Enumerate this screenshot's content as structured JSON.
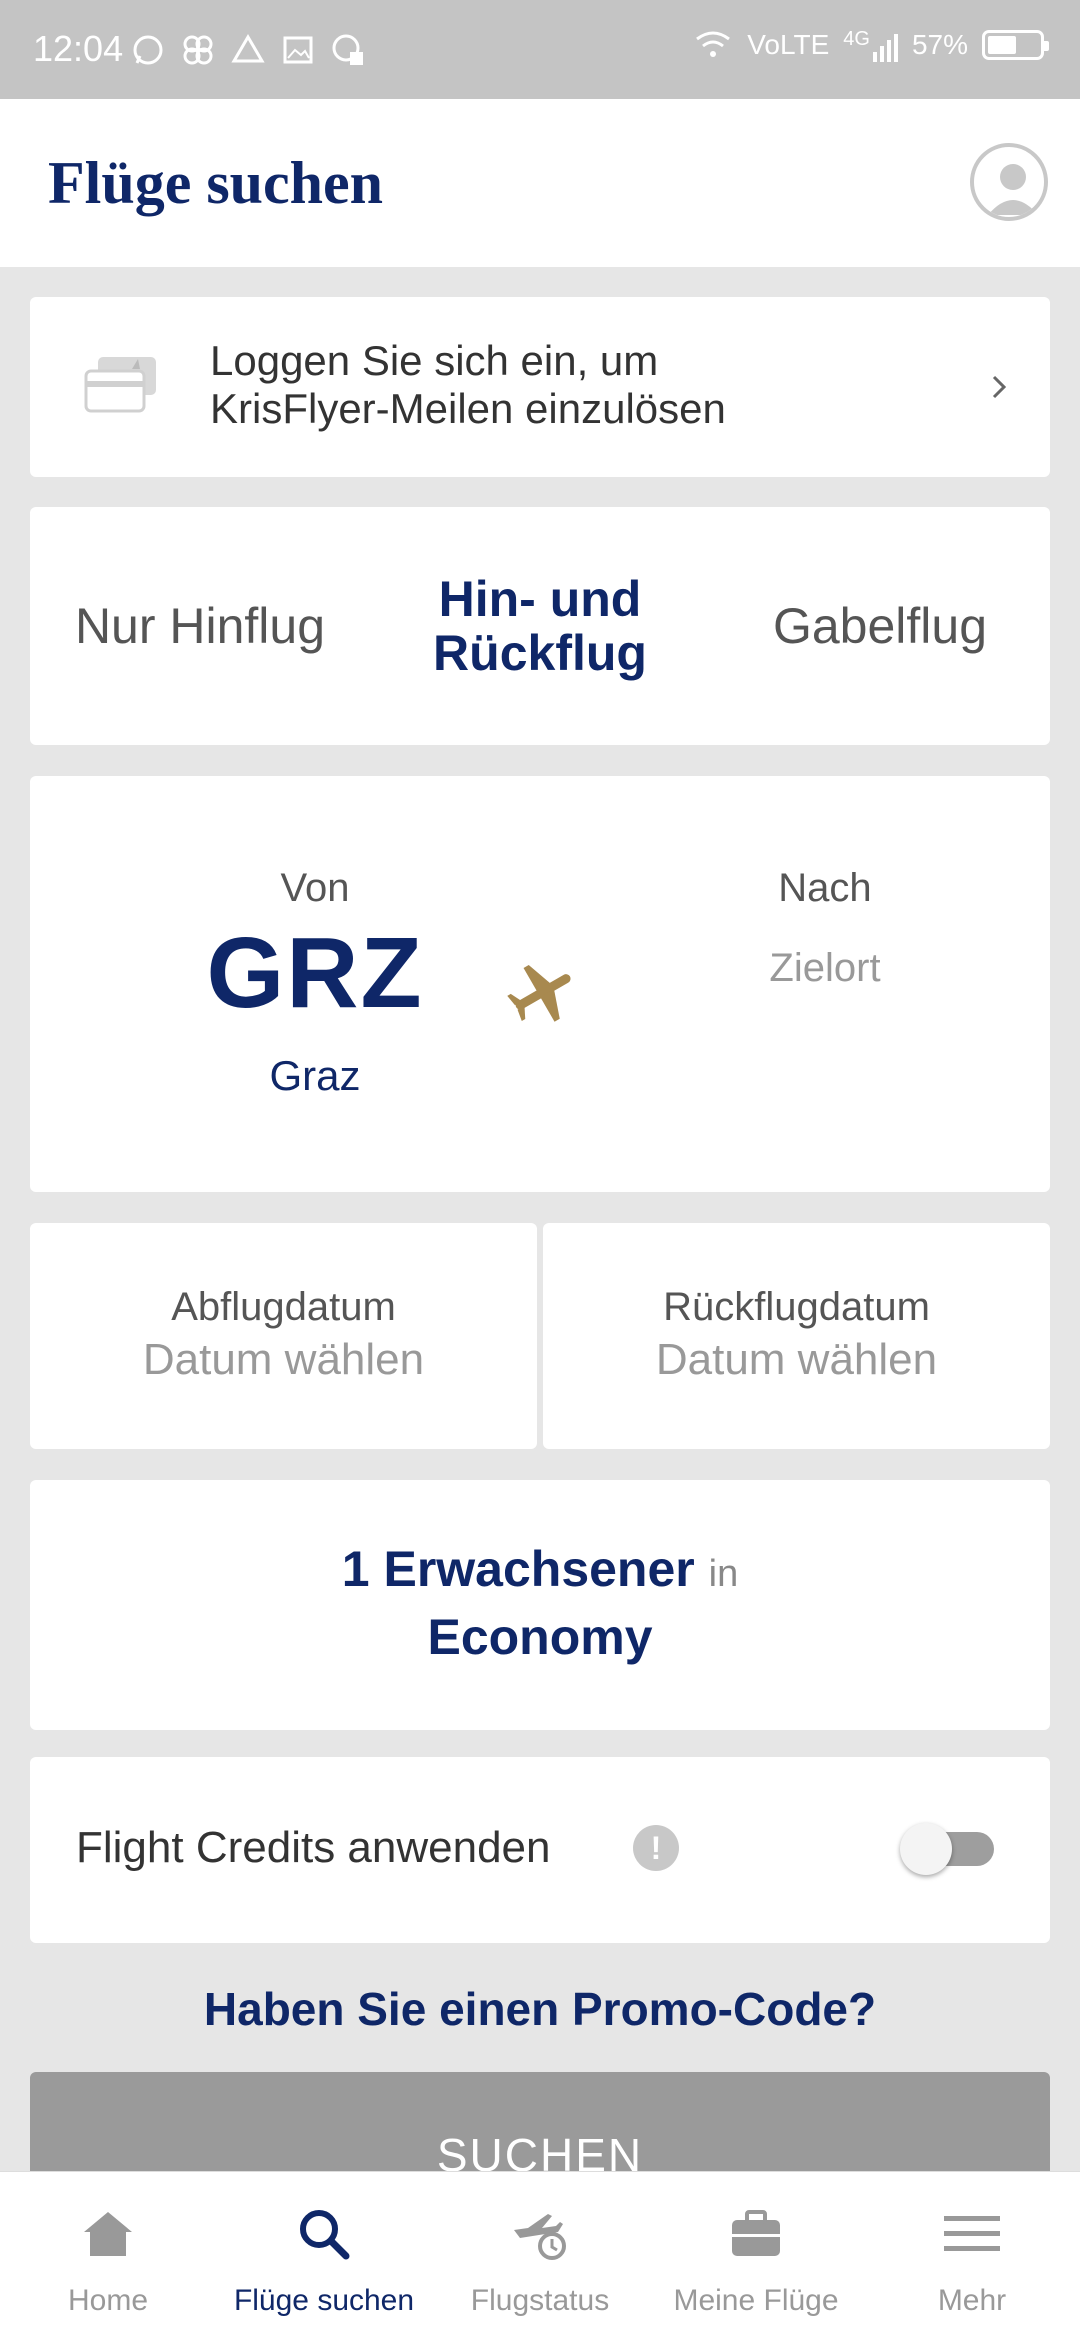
{
  "status_bar": {
    "time": "12:04",
    "network": "VoLTE",
    "signal": "4G",
    "battery": "57%",
    "notification_icons": [
      "whatsapp-icon",
      "pinwheel-icon",
      "drive-icon",
      "gallery-icon",
      "clock-icon"
    ]
  },
  "header": {
    "title": "Flüge suchen",
    "profile_icon": "user-avatar-icon"
  },
  "login_banner": {
    "line1": "Loggen Sie sich ein, um",
    "line2": "KrisFlyer-Meilen einzulösen",
    "icon": "credit-card-icon"
  },
  "trip_type": {
    "options": [
      {
        "label": "Nur Hinflug",
        "selected": false
      },
      {
        "label_line1": "Hin- und",
        "label_line2": "Rückflug",
        "selected": true
      },
      {
        "label": "Gabelflug",
        "selected": false
      }
    ]
  },
  "route": {
    "from_label": "Von",
    "from_code": "GRZ",
    "from_city": "Graz",
    "to_label": "Nach",
    "to_placeholder": "Zielort"
  },
  "dates": {
    "departure_label": "Abflugdatum",
    "departure_value": "Datum wählen",
    "return_label": "Rückflugdatum",
    "return_value": "Datum wählen"
  },
  "passengers": {
    "count_text": "1 Erwachsener",
    "in_text": "in",
    "cabin": "Economy"
  },
  "flight_credits": {
    "label": "Flight Credits anwenden",
    "info_glyph": "!",
    "enabled": false
  },
  "promo_link": "Haben Sie einen Promo-Code?",
  "search_button": "SUCHEN",
  "bottom_nav": {
    "items": [
      {
        "label": "Home",
        "icon": "home-icon",
        "active": false
      },
      {
        "label": "Flüge suchen",
        "icon": "search-icon",
        "active": true
      },
      {
        "label": "Flugstatus",
        "icon": "flight-status-icon",
        "active": false
      },
      {
        "label": "Meine Flüge",
        "icon": "briefcase-icon",
        "active": false
      },
      {
        "label": "Mehr",
        "icon": "menu-icon",
        "active": false
      }
    ]
  },
  "colors": {
    "brand_navy": "#0f2768",
    "gold": "#a8894f",
    "status_bar": "#c4c4c4",
    "background": "#e6e6e6"
  }
}
